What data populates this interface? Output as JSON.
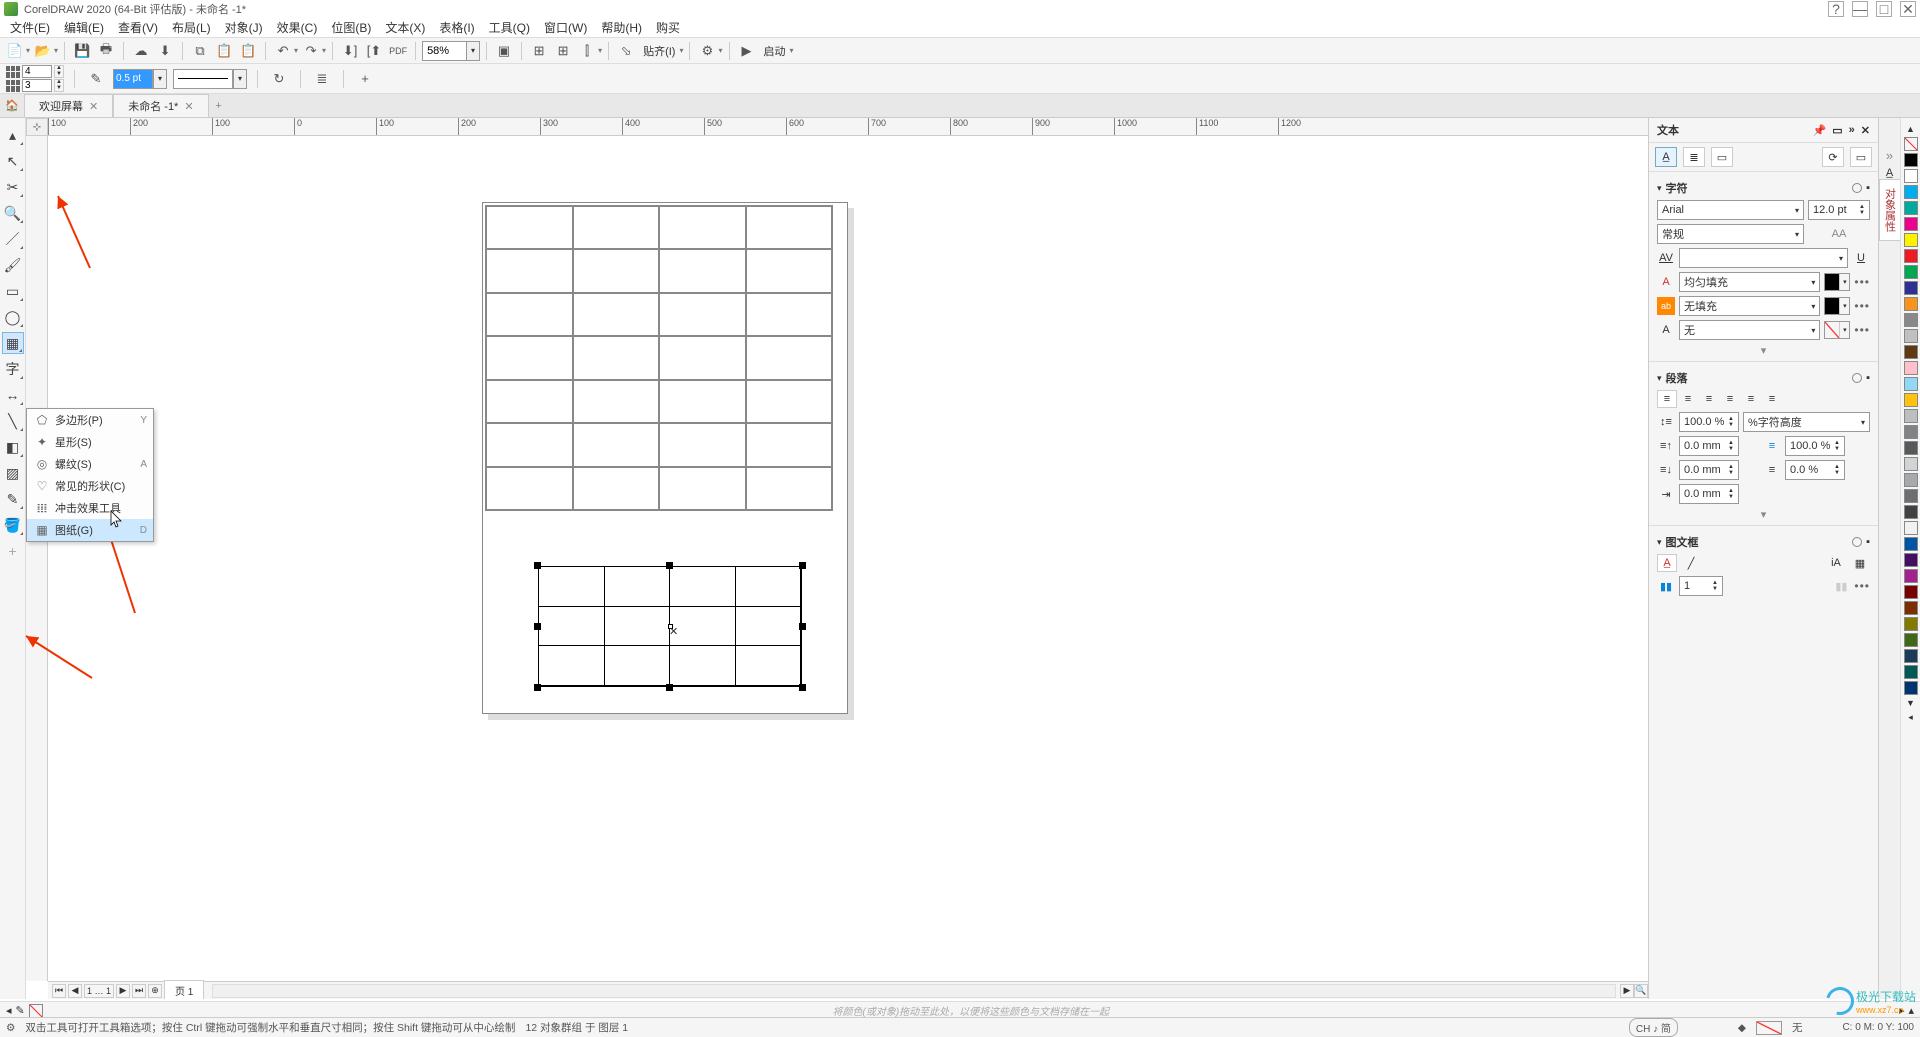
{
  "app": {
    "title": "CorelDRAW 2020 (64-Bit 评估版) - 未命名 -1*"
  },
  "menu": [
    "文件(E)",
    "编辑(E)",
    "查看(V)",
    "布局(L)",
    "对象(J)",
    "效果(C)",
    "位图(B)",
    "文本(X)",
    "表格(I)",
    "工具(Q)",
    "窗口(W)",
    "帮助(H)",
    "购买"
  ],
  "toolbar": {
    "zoom": "58%",
    "align_label": "贴齐(I)",
    "launch_label": "启动"
  },
  "propbar": {
    "cols": "4",
    "rows": "3",
    "outline_width": "0.5 pt"
  },
  "tabs": {
    "welcome": "欢迎屏幕",
    "doc": "未命名 -1*"
  },
  "ruler_h": [
    "100",
    "200",
    "100",
    "0",
    "100",
    "200",
    "300",
    "400",
    "500",
    "600",
    "700",
    "800",
    "900",
    "1000",
    "1100",
    "1200"
  ],
  "flyout": [
    {
      "icon": "⬠",
      "label": "多边形(P)",
      "key": "Y"
    },
    {
      "icon": "✦",
      "label": "星形(S)",
      "key": ""
    },
    {
      "icon": "◎",
      "label": "螺纹(S)",
      "key": "A"
    },
    {
      "icon": "♡",
      "label": "常见的形状(C)",
      "key": ""
    },
    {
      "icon": "𝍖",
      "label": "冲击效果工具",
      "key": ""
    },
    {
      "icon": "▦",
      "label": "图纸(G)",
      "key": "D"
    }
  ],
  "pagenav": {
    "page_label": "页 1"
  },
  "bottom_hint": "将颜色(或对象)拖动至此处，以便将这些颜色与文档存储在一起",
  "status": {
    "hint": "双击工具可打开工具箱选项；按住 Ctrl 键拖动可强制水平和垂直尺寸相同；按住 Shift 键拖动可从中心绘制",
    "selection": "12 对象群组 于 图层 1",
    "ime": "CH ♪ 简",
    "fill_label": "无",
    "coords_x_label": "0 M:",
    "coords_y_label": "0 Y:",
    "coords_val": "100"
  },
  "docker": {
    "title": "文本",
    "side_tab1": "对象属性",
    "section_char": "字符",
    "font": "Arial",
    "font_size": "12.0 pt",
    "font_style": "常规",
    "fill_type": "均匀填充",
    "bg_fill": "无填充",
    "outline_type": "无",
    "section_para": "段落",
    "line_spacing": "100.0 %",
    "line_spacing_units": "%字符高度",
    "before": "0.0 mm",
    "after": "0.0 mm",
    "indent": "0.0 mm",
    "right_pct": "100.0 %",
    "right_pct2": "0.0 %",
    "section_frame": "图文框",
    "columns": "1"
  },
  "palette": [
    "#000000",
    "#ffffff",
    "#00aeef",
    "#ec008c",
    "#fff200",
    "#ed1c24",
    "#00a651",
    "#2e3192",
    "#f7941d",
    "#898989",
    "#c0c0c0",
    "#603913",
    "#ffc0cb",
    "#00ffff",
    "#91d8f7",
    "#ff00ff",
    "#bcbec0",
    "#808285",
    "#58595b",
    "#d1d3d4"
  ],
  "watermark": {
    "name": "极光下载站",
    "url": "www.xz7.co"
  }
}
